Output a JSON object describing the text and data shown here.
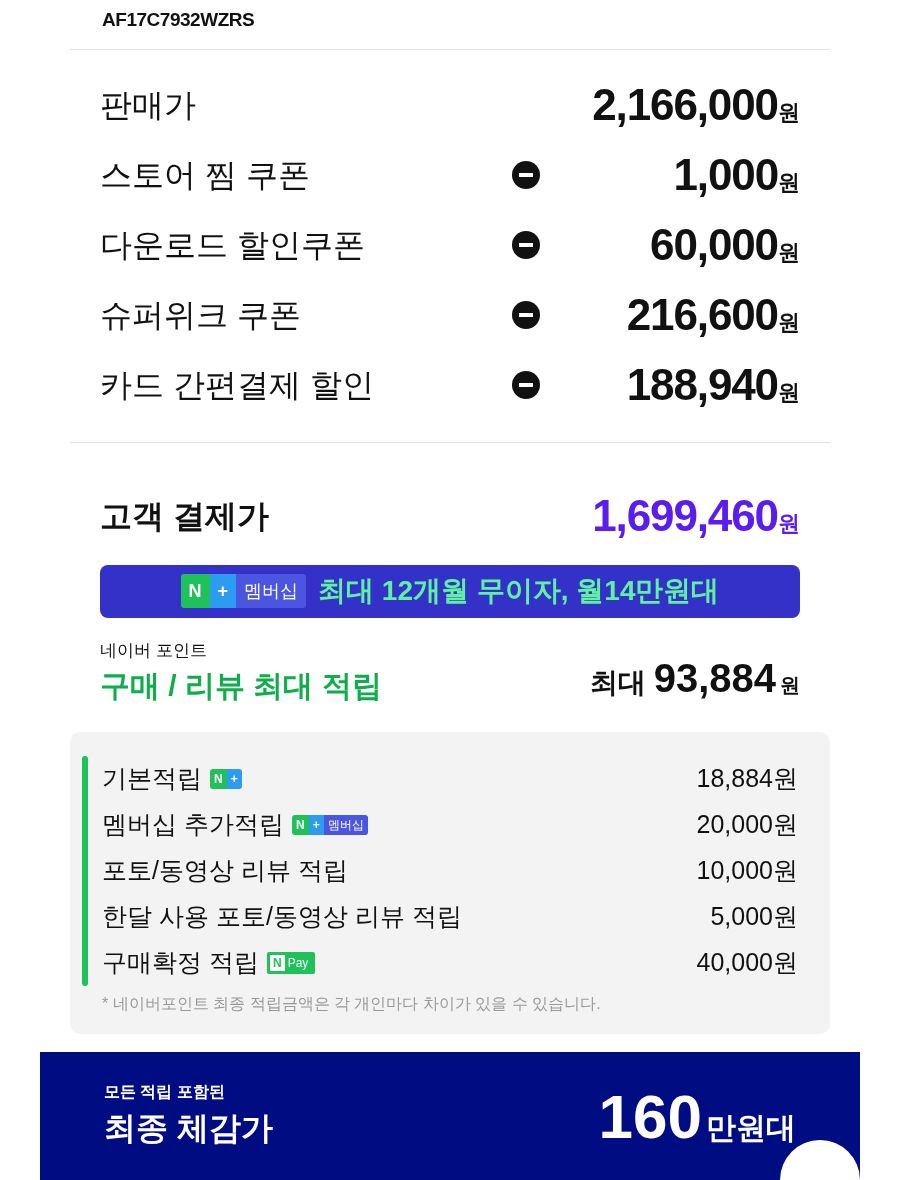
{
  "product_code": "AF17C7932WZRS",
  "price_rows": [
    {
      "label": "판매가",
      "amount": "2,166,000",
      "unit": "원",
      "kind": "base"
    },
    {
      "label": "스토어 찜 쿠폰",
      "amount": "1,000",
      "unit": "원",
      "kind": "discount"
    },
    {
      "label": "다운로드 할인쿠폰",
      "amount": "60,000",
      "unit": "원",
      "kind": "discount"
    },
    {
      "label": "슈퍼위크 쿠폰",
      "amount": "216,600",
      "unit": "원",
      "kind": "discount"
    },
    {
      "label": "카드 간편결제 할인",
      "amount": "188,940",
      "unit": "원",
      "kind": "discount"
    }
  ],
  "customer_price": {
    "label": "고객 결제가",
    "amount": "1,699,460",
    "unit": "원"
  },
  "membership_banner": {
    "badge": {
      "kind": "segments",
      "parts": [
        {
          "text": "N",
          "color": "#1fc15a"
        },
        {
          "text": "+",
          "color": "#2d9bf0"
        },
        {
          "text": "멤버십",
          "color": "#4a55e0"
        }
      ]
    },
    "text": "최대 12개월 무이자, 월14만원대"
  },
  "points": {
    "caption": "네이버 포인트",
    "headline": "구매 / 리뷰 최대 적립",
    "prefix": "최대",
    "amount": "93,884",
    "unit": "원",
    "items": [
      {
        "label": "기본적립",
        "badge": {
          "kind": "segments",
          "parts": [
            {
              "text": "N",
              "color": "#1fc15a"
            },
            {
              "text": "+",
              "color": "#2d9bf0"
            }
          ]
        },
        "amount": "18,884원"
      },
      {
        "label": "멤버십 추가적립",
        "badge": {
          "kind": "segments",
          "parts": [
            {
              "text": "N",
              "color": "#1fc15a"
            },
            {
              "text": "+",
              "color": "#2d9bf0"
            },
            {
              "text": "멤버십",
              "color": "#4a55e0"
            }
          ]
        },
        "amount": "20,000원"
      },
      {
        "label": "포토/동영상 리뷰 적립",
        "amount": "10,000원"
      },
      {
        "label": "한달 사용 포토/동영상 리뷰 적립",
        "amount": "5,000원"
      },
      {
        "label": "구매확정 적립",
        "badge": {
          "kind": "npay",
          "parts": [
            {
              "text": "N",
              "color": "#1fc15a"
            },
            {
              "text": "Pay",
              "color": "#1fc15a"
            }
          ]
        },
        "amount": "40,000원"
      }
    ],
    "note": "* 네이버포인트 최종 적립금액은 각 개인마다 차이가 있을 수 있습니다."
  },
  "final": {
    "caption": "모든 적립 포함된",
    "label": "최종 체감가",
    "amount": "160",
    "unit": "만원대"
  }
}
